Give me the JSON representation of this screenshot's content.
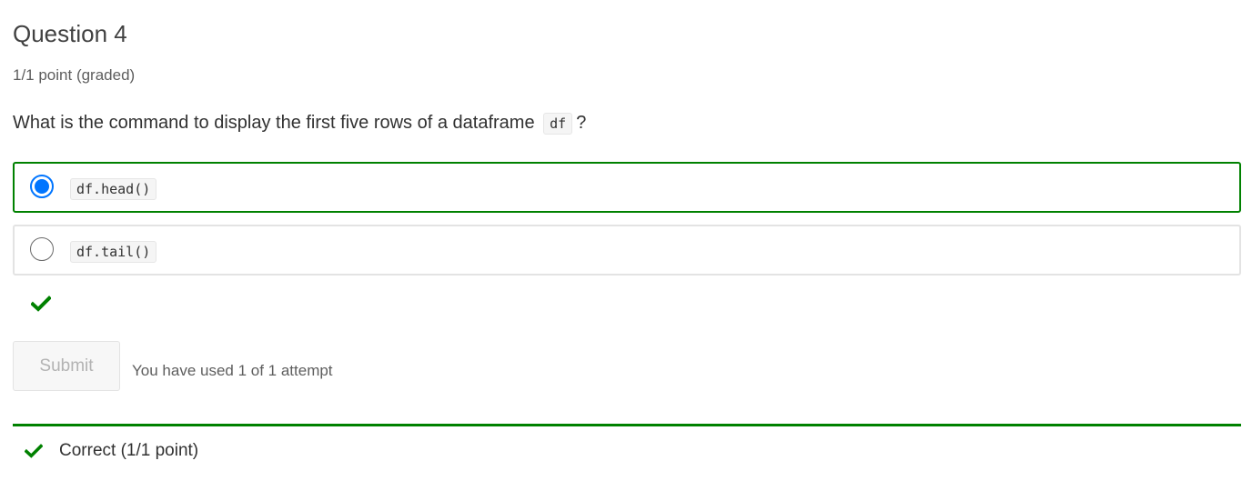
{
  "question": {
    "title": "Question 4",
    "points": "1/1 point (graded)",
    "prompt_before": "What is the command to display the first five rows of a dataframe",
    "prompt_code": "df",
    "prompt_after": "?"
  },
  "options": [
    {
      "code": "df.head()",
      "selected": true,
      "state": "correct"
    },
    {
      "code": "df.tail()",
      "selected": false,
      "state": "unselected"
    }
  ],
  "actions": {
    "submit_label": "Submit",
    "attempts_text": "You have used 1 of 1 attempt"
  },
  "feedback": {
    "text": "Correct (1/1 point)"
  },
  "colors": {
    "correct_green": "#008100",
    "radio_blue": "#0075ff",
    "border_gray": "#e3e3e3"
  },
  "icons": {
    "answer_status": "checkmark-icon",
    "feedback_status": "checkmark-icon"
  }
}
